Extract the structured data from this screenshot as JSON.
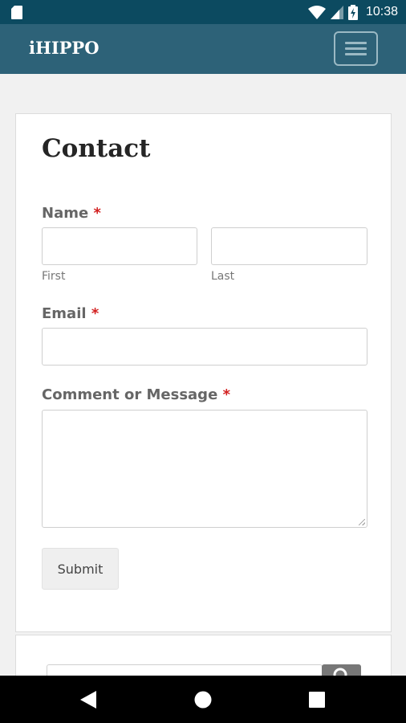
{
  "status_bar": {
    "time": "10:38"
  },
  "app_bar": {
    "brand": "iHIPPO"
  },
  "form": {
    "title": "Contact",
    "required_mark": "*",
    "name_label": "Name",
    "first_sublabel": "First",
    "last_sublabel": "Last",
    "email_label": "Email",
    "message_label": "Comment or Message",
    "submit_label": "Submit"
  },
  "icons": {
    "sd_card": "sd-card-icon",
    "wifi": "wifi-icon",
    "signal": "signal-icon",
    "battery": "battery-charging-icon",
    "menu": "hamburger-menu-icon",
    "search": "search-icon",
    "back": "back-icon",
    "home": "home-icon",
    "recents": "recents-icon"
  },
  "colors": {
    "status_bar": "#0c4a60",
    "app_bar": "#2d6278",
    "required": "#d21f1f"
  }
}
